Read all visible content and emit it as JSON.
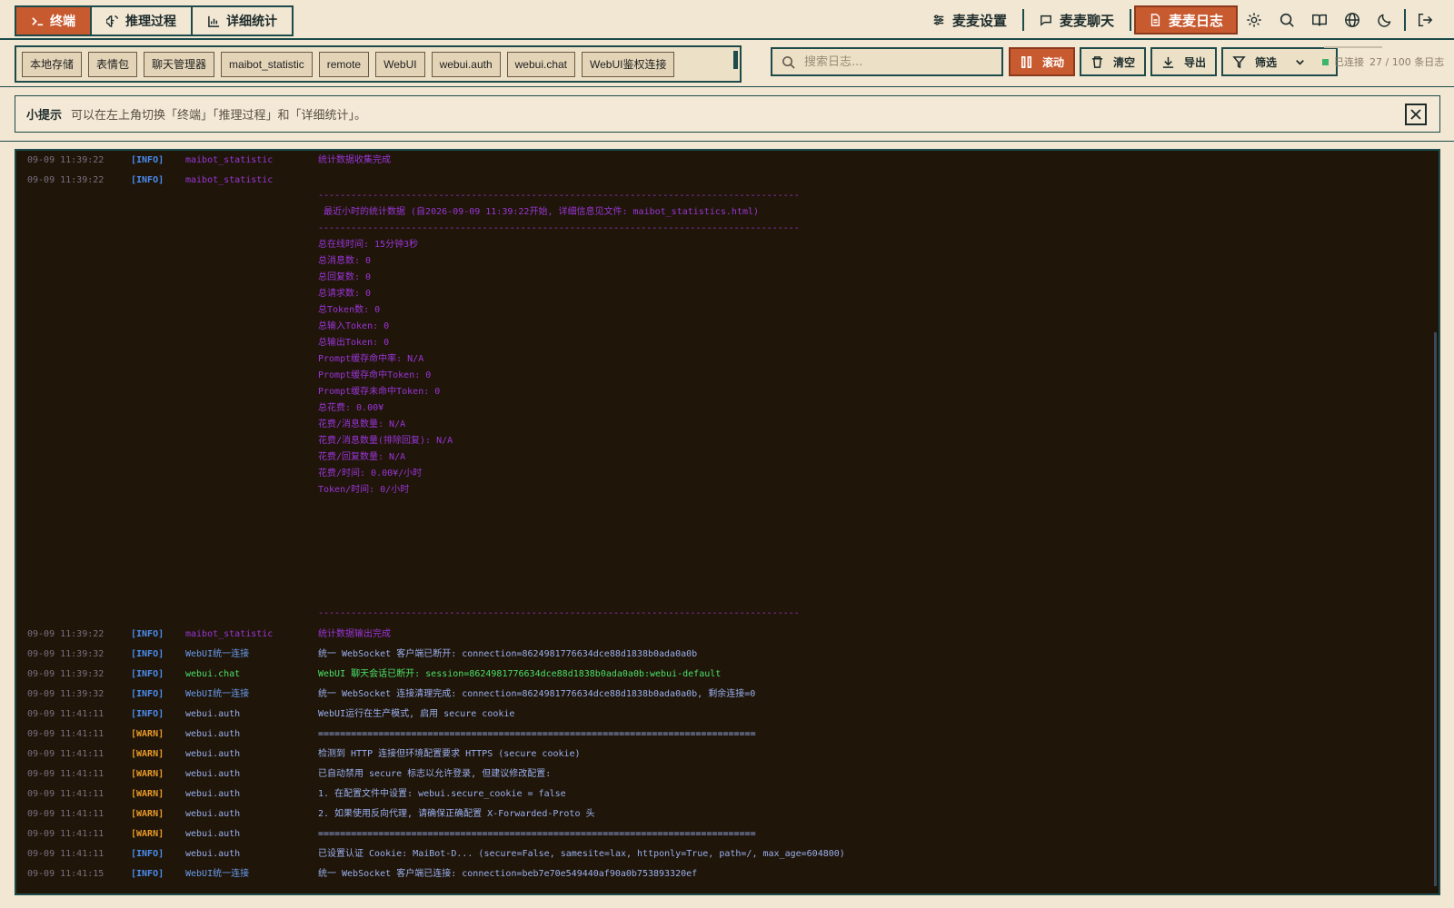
{
  "view_tabs": [
    {
      "label": "终端",
      "icon": "terminal-icon",
      "active": true
    },
    {
      "label": "推理过程",
      "icon": "brain-icon",
      "active": false
    },
    {
      "label": "详细统计",
      "icon": "bar-chart-icon",
      "active": false
    }
  ],
  "nav": {
    "settings": "麦麦设置",
    "chat": "麦麦聊天",
    "logs": "麦麦日志"
  },
  "module_chips": [
    "本地存储",
    "表情包",
    "聊天管理器",
    "maibot_statistic",
    "remote",
    "WebUI",
    "webui.auth",
    "webui.chat",
    "WebUI鉴权连接"
  ],
  "search": {
    "placeholder": "搜索日志..."
  },
  "toolbar": {
    "scroll": "滚动",
    "clear": "清空",
    "export": "导出",
    "filter": "筛选"
  },
  "status": {
    "connected": "已连接",
    "count": "27 / 100 条日志"
  },
  "tip": {
    "title": "小提示",
    "text": "可以在左上角切换「终端」「推理过程」和「详细统计」。"
  },
  "colors": {
    "accent": "#c85a30",
    "border": "#1d4a4a",
    "terminal_bg": "#1f1508",
    "info": "#4a8cf0",
    "warn": "#e89a2c",
    "statistic": "#9a35d8",
    "chat": "#4ae06a"
  },
  "logs": [
    {
      "ts": "09-09 11:39:22",
      "level": "[INFO]",
      "module": "maibot_statistic",
      "msg": "统计数据收集完成",
      "mclass": "c-purple",
      "lclass": "c-info",
      "tclass": "c-purple"
    },
    {
      "ts": "09-09 11:39:22",
      "level": "[INFO]",
      "module": "maibot_statistic",
      "msg": "",
      "mclass": "c-purple",
      "lclass": "c-info",
      "tclass": "c-purple"
    },
    {
      "ts": "",
      "level": "",
      "module": "",
      "msg": "----------------------------------------------------------------------------------------",
      "mclass": "",
      "lclass": "",
      "tclass": "c-purple"
    },
    {
      "ts": "",
      "level": "",
      "module": "",
      "msg": " 最近小时的统计数据 (自2026-09-09 11:39:22开始, 详细信息见文件: maibot_statistics.html)",
      "mclass": "",
      "lclass": "",
      "tclass": "c-purple"
    },
    {
      "ts": "",
      "level": "",
      "module": "",
      "msg": "----------------------------------------------------------------------------------------",
      "mclass": "",
      "lclass": "",
      "tclass": "c-purple"
    },
    {
      "ts": "",
      "level": "",
      "module": "",
      "msg": "总在线时间: 15分钟3秒",
      "mclass": "",
      "lclass": "",
      "tclass": "c-purple"
    },
    {
      "ts": "",
      "level": "",
      "module": "",
      "msg": "总消息数: 0",
      "mclass": "",
      "lclass": "",
      "tclass": "c-purple"
    },
    {
      "ts": "",
      "level": "",
      "module": "",
      "msg": "总回复数: 0",
      "mclass": "",
      "lclass": "",
      "tclass": "c-purple"
    },
    {
      "ts": "",
      "level": "",
      "module": "",
      "msg": "总请求数: 0",
      "mclass": "",
      "lclass": "",
      "tclass": "c-purple"
    },
    {
      "ts": "",
      "level": "",
      "module": "",
      "msg": "总Token数: 0",
      "mclass": "",
      "lclass": "",
      "tclass": "c-purple"
    },
    {
      "ts": "",
      "level": "",
      "module": "",
      "msg": "总输入Token: 0",
      "mclass": "",
      "lclass": "",
      "tclass": "c-purple"
    },
    {
      "ts": "",
      "level": "",
      "module": "",
      "msg": "总输出Token: 0",
      "mclass": "",
      "lclass": "",
      "tclass": "c-purple"
    },
    {
      "ts": "",
      "level": "",
      "module": "",
      "msg": "Prompt缓存命中率: N/A",
      "mclass": "",
      "lclass": "",
      "tclass": "c-purple"
    },
    {
      "ts": "",
      "level": "",
      "module": "",
      "msg": "Prompt缓存命中Token: 0",
      "mclass": "",
      "lclass": "",
      "tclass": "c-purple"
    },
    {
      "ts": "",
      "level": "",
      "module": "",
      "msg": "Prompt缓存未命中Token: 0",
      "mclass": "",
      "lclass": "",
      "tclass": "c-purple"
    },
    {
      "ts": "",
      "level": "",
      "module": "",
      "msg": "总花费: 0.00¥",
      "mclass": "",
      "lclass": "",
      "tclass": "c-purple"
    },
    {
      "ts": "",
      "level": "",
      "module": "",
      "msg": "花费/消息数量: N/A",
      "mclass": "",
      "lclass": "",
      "tclass": "c-purple"
    },
    {
      "ts": "",
      "level": "",
      "module": "",
      "msg": "花费/消息数量(排除回复): N/A",
      "mclass": "",
      "lclass": "",
      "tclass": "c-purple"
    },
    {
      "ts": "",
      "level": "",
      "module": "",
      "msg": "花费/回复数量: N/A",
      "mclass": "",
      "lclass": "",
      "tclass": "c-purple"
    },
    {
      "ts": "",
      "level": "",
      "module": "",
      "msg": "花费/时间: 0.00¥/小时",
      "mclass": "",
      "lclass": "",
      "tclass": "c-purple"
    },
    {
      "ts": "",
      "level": "",
      "module": "",
      "msg": "Token/时间: 0/小时",
      "mclass": "",
      "lclass": "",
      "tclass": "c-purple"
    },
    {
      "ts": "",
      "level": "",
      "module": "",
      "msg": "----------------------------------------------------------------------------------------",
      "mclass": "",
      "lclass": "",
      "tclass": "c-purple"
    },
    {
      "ts": "09-09 11:39:22",
      "level": "[INFO]",
      "module": "maibot_statistic",
      "msg": "统计数据输出完成",
      "mclass": "c-purple",
      "lclass": "c-info",
      "tclass": "c-purple"
    },
    {
      "ts": "09-09 11:39:32",
      "level": "[INFO]",
      "module": "WebUI统一连接",
      "msg": "统一 WebSocket 客户端已断开: connection=8624981776634dce88d1838b0ada0a0b",
      "mclass": "c-blue",
      "lclass": "c-info",
      "tclass": "c-text"
    },
    {
      "ts": "09-09 11:39:32",
      "level": "[INFO]",
      "module": "webui.chat",
      "msg": "WebUI 聊天会话已断开: session=8624981776634dce88d1838b0ada0a0b:webui-default",
      "mclass": "c-green",
      "lclass": "c-info",
      "tclass": "c-green"
    },
    {
      "ts": "09-09 11:39:32",
      "level": "[INFO]",
      "module": "WebUI统一连接",
      "msg": "统一 WebSocket 连接清理完成: connection=8624981776634dce88d1838b0ada0a0b, 剩余连接=0",
      "mclass": "c-blue",
      "lclass": "c-info",
      "tclass": "c-text"
    },
    {
      "ts": "09-09 11:41:11",
      "level": "[INFO]",
      "module": "webui.auth",
      "msg": "WebUI运行在生产模式, 启用 secure cookie",
      "mclass": "c-text",
      "lclass": "c-info",
      "tclass": "c-text"
    },
    {
      "ts": "09-09 11:41:11",
      "level": "[WARN]",
      "module": "webui.auth",
      "msg": "================================================================================",
      "mclass": "c-text",
      "lclass": "c-warn",
      "tclass": "c-text"
    },
    {
      "ts": "09-09 11:41:11",
      "level": "[WARN]",
      "module": "webui.auth",
      "msg": "检测到 HTTP 连接但环境配置要求 HTTPS (secure cookie)",
      "mclass": "c-text",
      "lclass": "c-warn",
      "tclass": "c-text"
    },
    {
      "ts": "09-09 11:41:11",
      "level": "[WARN]",
      "module": "webui.auth",
      "msg": "已自动禁用 secure 标志以允许登录, 但建议修改配置:",
      "mclass": "c-text",
      "lclass": "c-warn",
      "tclass": "c-text"
    },
    {
      "ts": "09-09 11:41:11",
      "level": "[WARN]",
      "module": "webui.auth",
      "msg": "1. 在配置文件中设置: webui.secure_cookie = false",
      "mclass": "c-text",
      "lclass": "c-warn",
      "tclass": "c-text"
    },
    {
      "ts": "09-09 11:41:11",
      "level": "[WARN]",
      "module": "webui.auth",
      "msg": "2. 如果使用反向代理, 请确保正确配置 X-Forwarded-Proto 头",
      "mclass": "c-text",
      "lclass": "c-warn",
      "tclass": "c-text"
    },
    {
      "ts": "09-09 11:41:11",
      "level": "[WARN]",
      "module": "webui.auth",
      "msg": "================================================================================",
      "mclass": "c-text",
      "lclass": "c-warn",
      "tclass": "c-text"
    },
    {
      "ts": "09-09 11:41:11",
      "level": "[INFO]",
      "module": "webui.auth",
      "msg": "已设置认证 Cookie: MaiBot-D... (secure=False, samesite=lax, httponly=True, path=/, max_age=604800)",
      "mclass": "c-text",
      "lclass": "c-info",
      "tclass": "c-text"
    },
    {
      "ts": "09-09 11:41:15",
      "level": "[INFO]",
      "module": "WebUI统一连接",
      "msg": "统一 WebSocket 客户端已连接: connection=beb7e70e549440af90a0b753893320ef",
      "mclass": "c-blue",
      "lclass": "c-info",
      "tclass": "c-text"
    }
  ]
}
